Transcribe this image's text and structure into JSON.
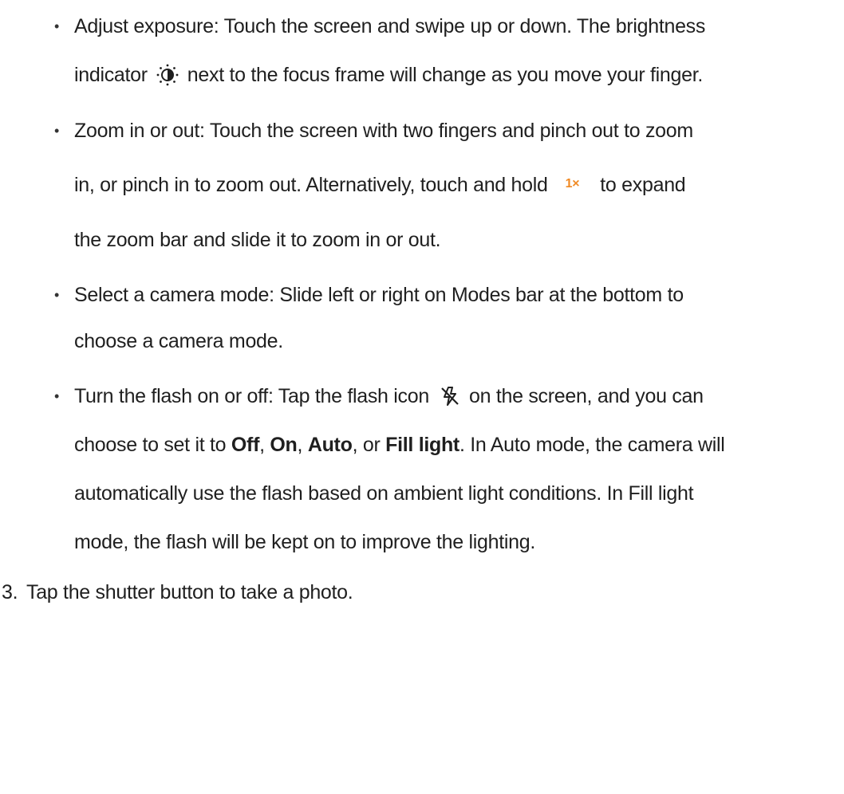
{
  "bullets": [
    {
      "lines": [
        {
          "text": "Adjust exposure: Touch the screen and swipe up or down. The brightness"
        },
        {
          "before_icon": "indicator",
          "icon": "brightness-icon",
          "after_icon": "next to the focus frame will change as you move your finger."
        }
      ]
    },
    {
      "lines": [
        {
          "text": "Zoom in or out: Touch the screen with two fingers and pinch out to zoom"
        },
        {
          "before_icon": "in, or pinch in to zoom out. Alternatively, touch and hold",
          "badge": "1×",
          "after_icon": "to expand"
        },
        {
          "text": "the zoom bar and slide it to zoom in or out."
        }
      ]
    },
    {
      "lines": [
        {
          "text": "Select a camera mode: Slide left or right on Modes bar at the bottom to"
        },
        {
          "text": "choose a camera mode."
        }
      ]
    },
    {
      "lines": [
        {
          "before_icon": "Turn the flash on or off: Tap the flash icon",
          "icon": "flash-off-icon",
          "after_icon": "on the screen, and you can"
        },
        {
          "pre": "choose to set it to ",
          "opt1": "Off",
          "sep1": ", ",
          "opt2": "On",
          "sep2": ", ",
          "opt3": "Auto",
          "sep3": ", or ",
          "opt4": "Fill light",
          "post": ". In Auto mode, the camera will"
        },
        {
          "text": "automatically use the flash based on ambient light conditions. In Fill light"
        },
        {
          "text": "mode, the flash will be kept on to improve the lighting."
        }
      ]
    }
  ],
  "bullet_char": "•",
  "step": {
    "number": "3.",
    "text": "Tap the shutter button to take a photo."
  },
  "colors": {
    "text": "#1f1f1f",
    "zoom_badge": "#f08a24"
  }
}
